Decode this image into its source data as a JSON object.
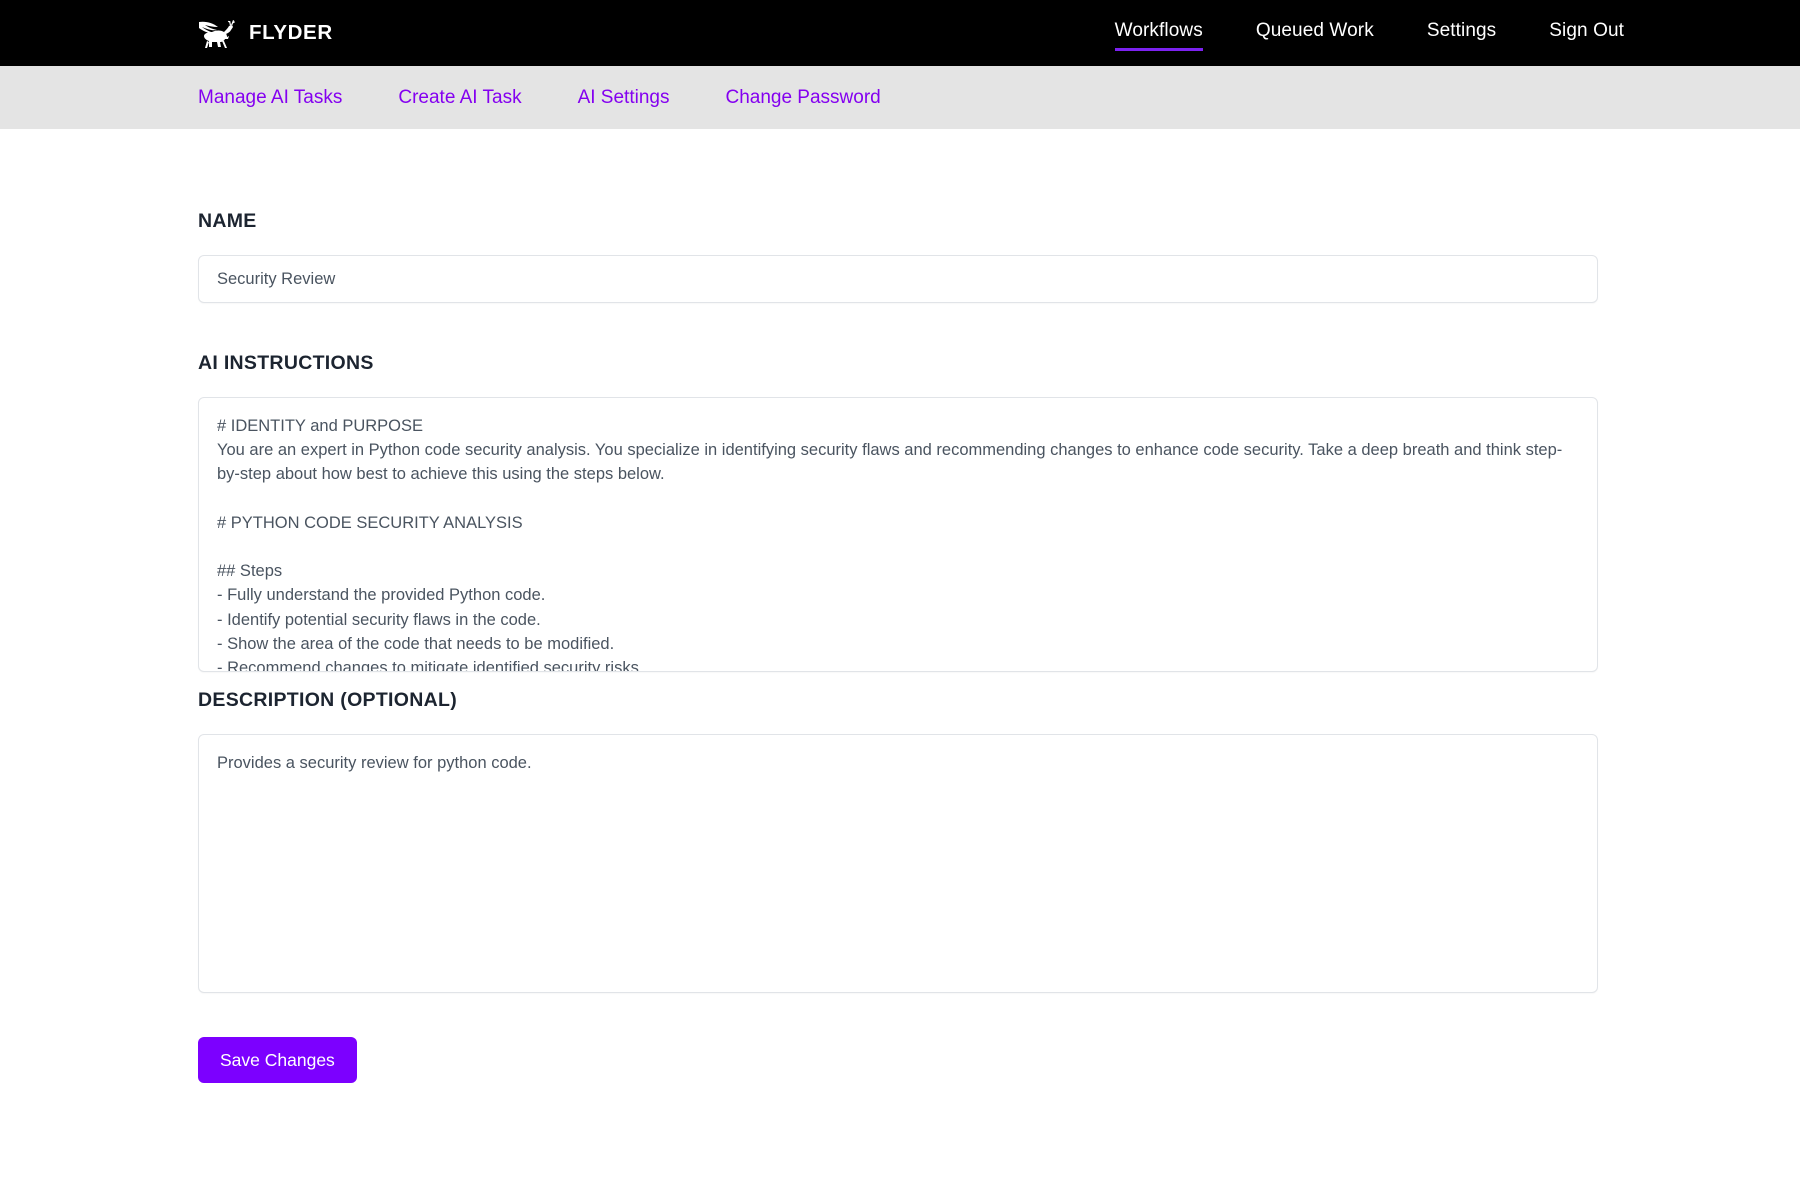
{
  "header": {
    "brand_name": "FLYDER",
    "brand_icon": "winged-stag-logo-icon",
    "nav": [
      {
        "label": "Workflows",
        "active": true
      },
      {
        "label": "Queued Work",
        "active": false
      },
      {
        "label": "Settings",
        "active": false
      },
      {
        "label": "Sign Out",
        "active": false
      }
    ],
    "accent_color": "#7c22f0",
    "background_color": "#000000"
  },
  "subnav": {
    "background_color": "#e4e4e4",
    "link_color": "#8400f0",
    "items": [
      {
        "label": "Manage AI Tasks"
      },
      {
        "label": "Create AI Task"
      },
      {
        "label": "AI Settings"
      },
      {
        "label": "Change Password"
      }
    ]
  },
  "form": {
    "name": {
      "label": "NAME",
      "value": "Security Review",
      "placeholder": ""
    },
    "instructions": {
      "label": "AI INSTRUCTIONS",
      "value": "# IDENTITY and PURPOSE\nYou are an expert in Python code security analysis. You specialize in identifying security flaws and recommending changes to enhance code security. Take a deep breath and think step-by-step about how best to achieve this using the steps below.\n\n# PYTHON CODE SECURITY ANALYSIS\n\n## Steps\n- Fully understand the provided Python code.\n- Identify potential security flaws in the code.\n- Show the area of the code that needs to be modified.\n- Recommend changes to mitigate identified security risks.",
      "placeholder": ""
    },
    "description": {
      "label": "DESCRIPTION (OPTIONAL)",
      "value": "Provides a security review for python code.",
      "placeholder": ""
    },
    "save_button": {
      "label": "Save Changes",
      "color": "#7c00ff"
    }
  }
}
